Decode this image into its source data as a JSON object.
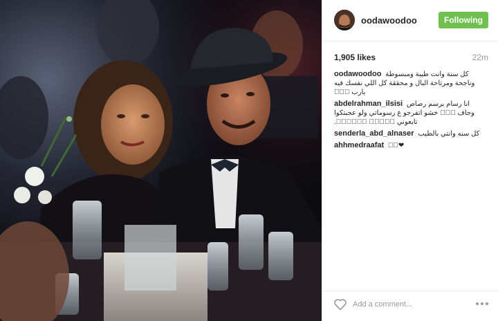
{
  "post": {
    "author": {
      "username": "oodawoodoo",
      "follow_label": "Following",
      "avatar_icon": "avatar-photo"
    },
    "likes": "1,905 likes",
    "time_ago": "22m",
    "comments": [
      {
        "user": "oodawoodoo",
        "text": "كل سنة وانت طيبة ومبسوطة وناجحة ومرتاحة البال و محققة كل اللي نفسك فيه يارب 🏻🏻🏻"
      },
      {
        "user": "abdelrahman_ilsisi",
        "text": "انا رسام برسم رصاص وجاف 🏻🏻🏻 خشو اتفرجو ع رسوماتي ولو عجبتكوا تابعوني 🏻🏻🏻🏻🏻 🏻🏻🏻🏻🏻🏻."
      },
      {
        "user": "senderla_abd_alnaser",
        "text": "كل سنه وانتي بالطيب"
      },
      {
        "user": "ahhmedraafat",
        "text": "❤❤🏻"
      }
    ],
    "add_comment_placeholder": "Add a comment...",
    "heart_icon": "heart-outline",
    "more_icon": "ellipsis-horizontal"
  },
  "colors": {
    "follow_button": "#70c050",
    "username": "#262626",
    "muted": "#999999",
    "divider": "#efefef"
  }
}
